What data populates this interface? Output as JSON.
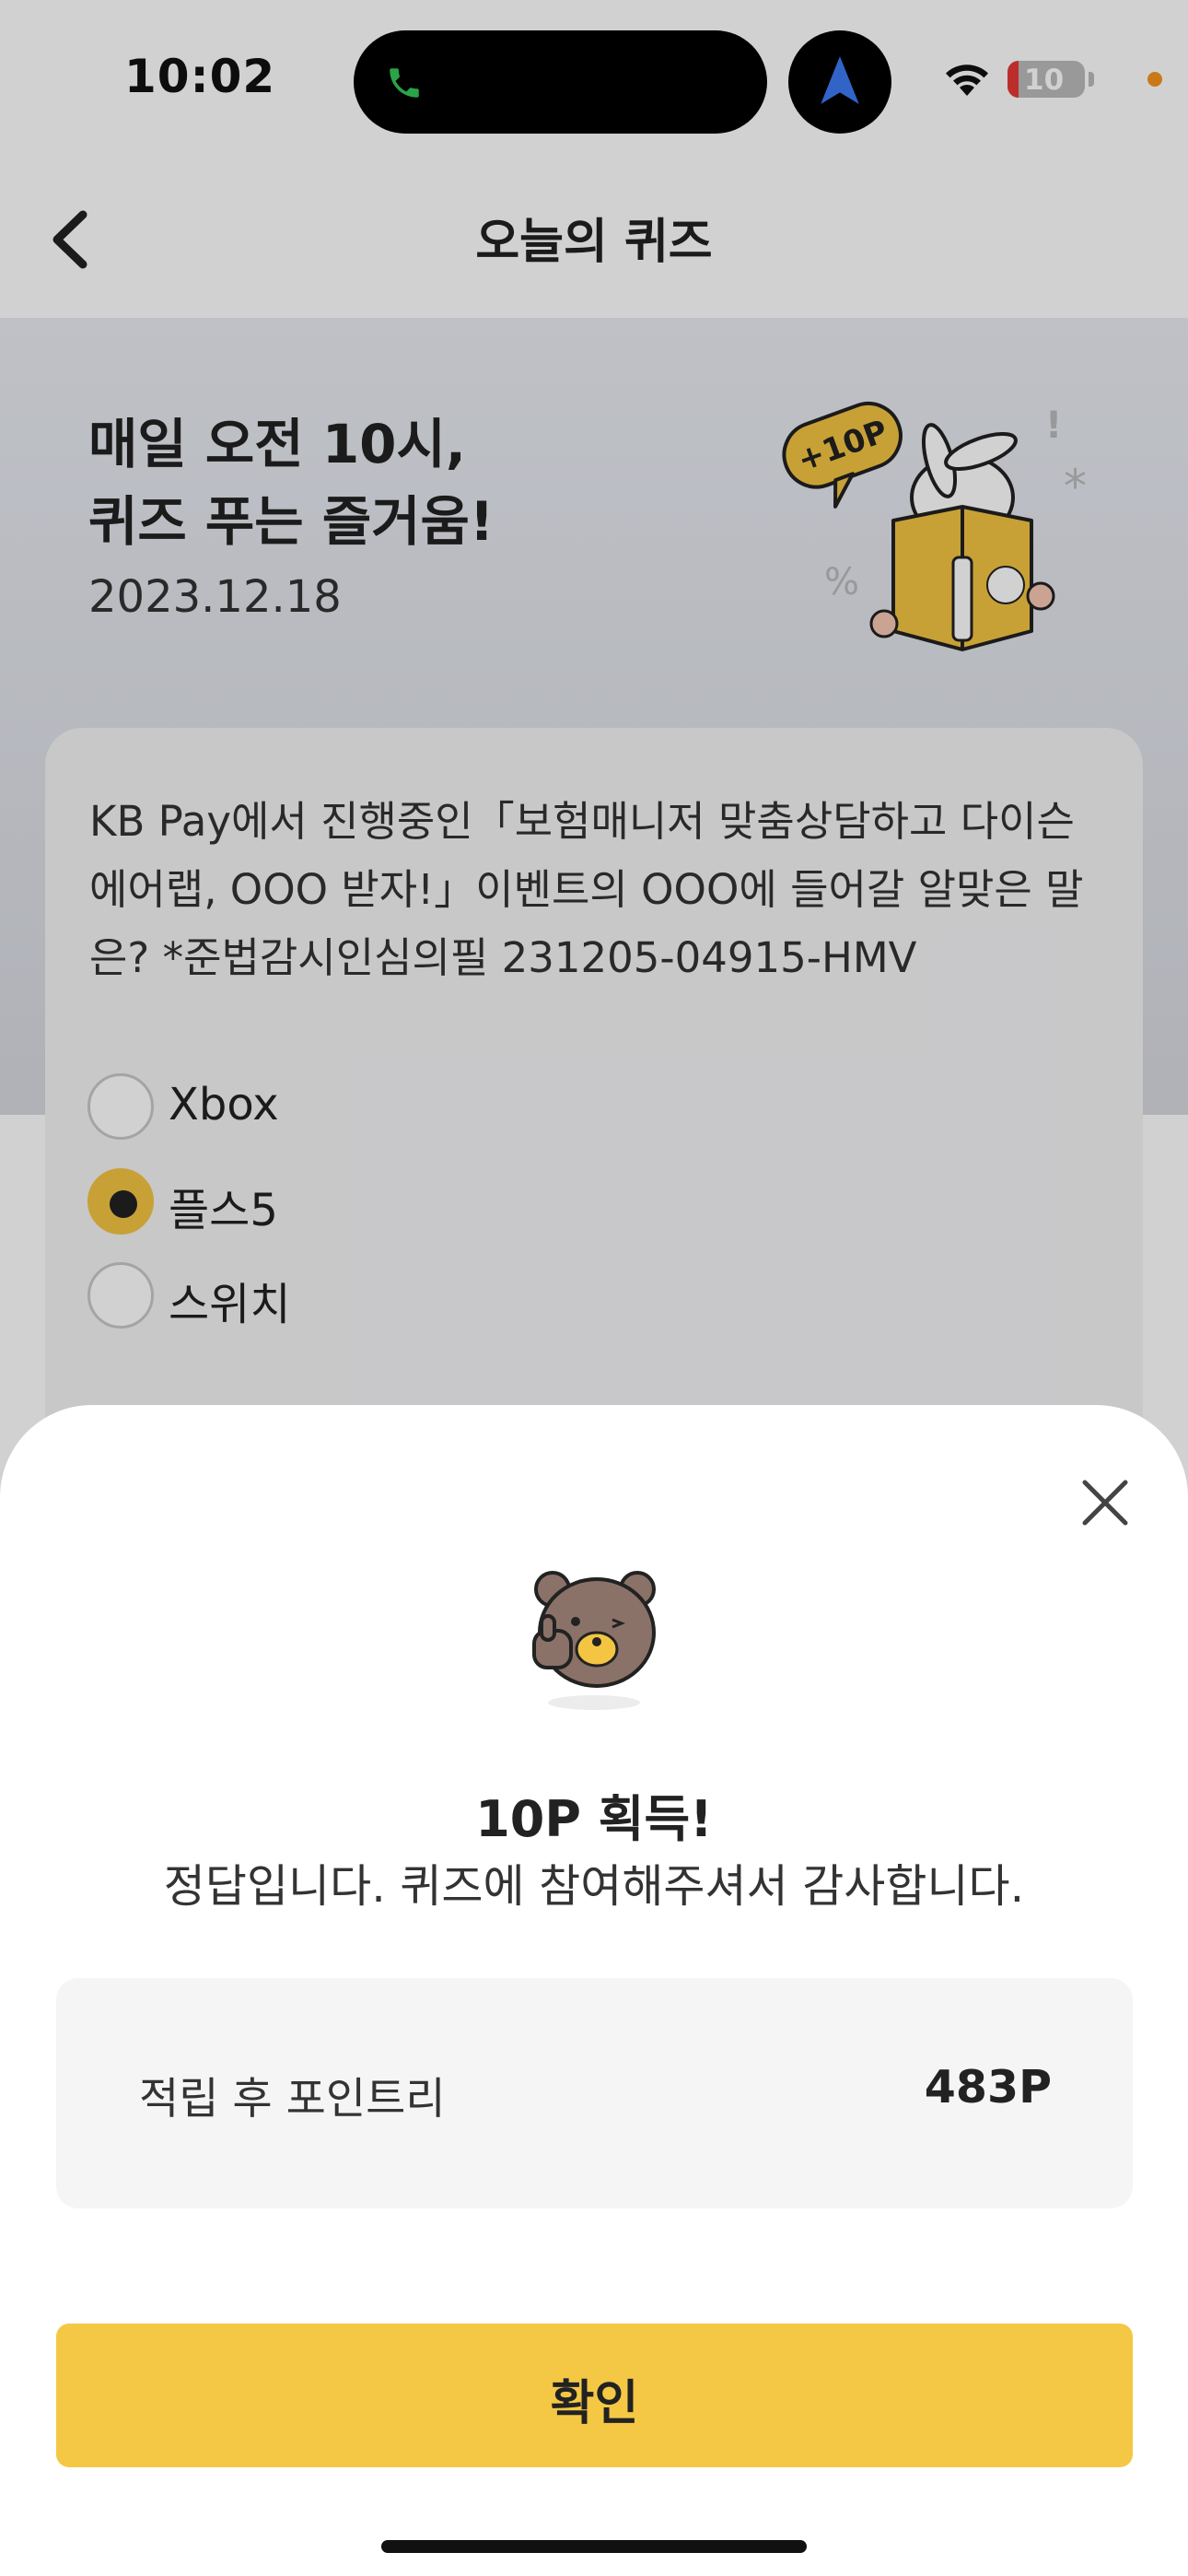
{
  "status_bar": {
    "time": "10:02",
    "battery_level": "10",
    "icons": [
      "phone-icon",
      "navigation-arrow-icon",
      "wifi-icon",
      "battery-icon"
    ]
  },
  "header": {
    "title": "오늘의 퀴즈",
    "back_icon": "chevron-left-icon"
  },
  "hero": {
    "title_line1": "매일 오전 10시,",
    "title_line2": "퀴즈 푸는 즐거움!",
    "date": "2023.12.18",
    "badge": "+10P"
  },
  "quiz": {
    "question": "KB Pay에서 진행중인「보험매니저 맞춤상담하고 다이슨 에어랩, OOO 받자!」이벤트의 OOO에 들어갈 알맞은 말은? *준법감시인심의필 231205-04915-HMV",
    "options": [
      {
        "label": "Xbox",
        "selected": false
      },
      {
        "label": "플스5",
        "selected": true
      },
      {
        "label": "스위치",
        "selected": false
      }
    ]
  },
  "result_sheet": {
    "title": "10P 획득!",
    "subtitle": "정답입니다. 퀴즈에 참여해주셔서 감사합니다.",
    "points_label": "적립 후 포인트리",
    "points_value": "483P",
    "confirm_label": "확인",
    "close_icon": "close-icon"
  },
  "colors": {
    "accent_yellow": "#f4c844",
    "hero_gradient_top": "#e9ecf3",
    "hero_gradient_bottom": "#d7d9e0"
  }
}
